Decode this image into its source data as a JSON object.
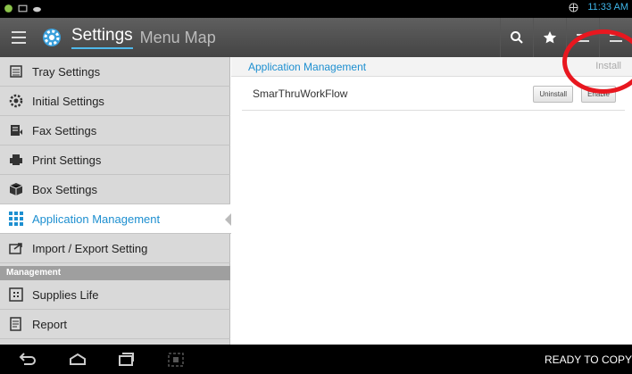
{
  "status_bar": {
    "time": "11:33 AM"
  },
  "header": {
    "title": "Settings",
    "subtitle": "Menu Map",
    "icons": [
      "menu-icon",
      "gear-icon",
      "search-icon",
      "star-icon",
      "list-icon",
      "more-icon"
    ]
  },
  "sidebar": {
    "items": [
      {
        "label": "Tray Settings",
        "icon": "tray-icon"
      },
      {
        "label": "Initial Settings",
        "icon": "settings-icon"
      },
      {
        "label": "Fax Settings",
        "icon": "fax-icon"
      },
      {
        "label": "Print Settings",
        "icon": "printer-icon"
      },
      {
        "label": "Box Settings",
        "icon": "box-icon"
      },
      {
        "label": "Application Management",
        "icon": "grid-icon",
        "active": true
      },
      {
        "label": "Import / Export Setting",
        "icon": "import-export-icon"
      }
    ],
    "section_label": "Management",
    "section_items": [
      {
        "label": "Supplies Life",
        "icon": "supplies-icon"
      },
      {
        "label": "Report",
        "icon": "report-icon"
      }
    ]
  },
  "main": {
    "title": "Application Management",
    "install_label": "Install",
    "apps": [
      {
        "name": "SmarThruWorkFlow",
        "uninstall_label": "Uninstall",
        "enable_label": "Enable"
      }
    ]
  },
  "nav_bar": {
    "status": "READY TO COPY"
  },
  "colors": {
    "accent": "#1d8fd0",
    "annotation": "#e8171f",
    "header_bg": "#555555"
  }
}
